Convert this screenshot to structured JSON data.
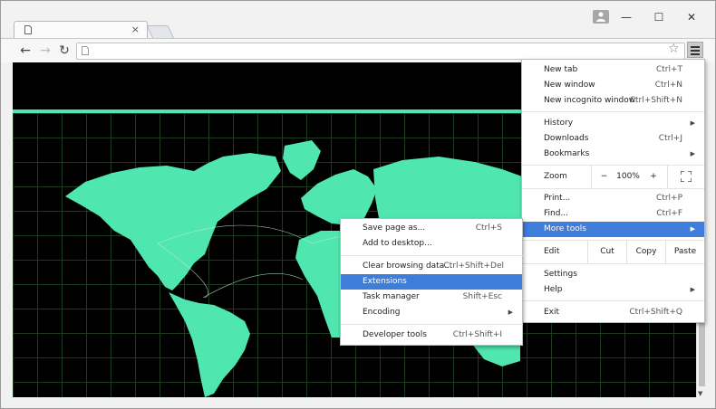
{
  "tab": {
    "title": "",
    "close": "×"
  },
  "window_controls": {
    "minimize": "—",
    "maximize": "☐",
    "close": "✕"
  },
  "nav": {
    "back": "←",
    "forward": "→",
    "reload": "↻"
  },
  "omnibox": {
    "value": "",
    "star": "☆"
  },
  "menu": {
    "new_tab": {
      "label": "New tab",
      "shortcut": "Ctrl+T"
    },
    "new_window": {
      "label": "New window",
      "shortcut": "Ctrl+N"
    },
    "new_incognito": {
      "label": "New incognito window",
      "shortcut": "Ctrl+Shift+N"
    },
    "history": {
      "label": "History"
    },
    "downloads": {
      "label": "Downloads",
      "shortcut": "Ctrl+J"
    },
    "bookmarks": {
      "label": "Bookmarks"
    },
    "zoom": {
      "label": "Zoom",
      "minus": "−",
      "value": "100%",
      "plus": "+",
      "fullscreen": "⛶"
    },
    "print": {
      "label": "Print...",
      "shortcut": "Ctrl+P"
    },
    "find": {
      "label": "Find...",
      "shortcut": "Ctrl+F"
    },
    "more_tools": {
      "label": "More tools"
    },
    "edit": {
      "label": "Edit",
      "cut": "Cut",
      "copy": "Copy",
      "paste": "Paste"
    },
    "settings": {
      "label": "Settings"
    },
    "help": {
      "label": "Help"
    },
    "exit": {
      "label": "Exit",
      "shortcut": "Ctrl+Shift+Q"
    }
  },
  "submenu": {
    "save_page": {
      "label": "Save page as...",
      "shortcut": "Ctrl+S"
    },
    "add_desktop": {
      "label": "Add to desktop..."
    },
    "clear_data": {
      "label": "Clear browsing data...",
      "shortcut": "Ctrl+Shift+Del"
    },
    "extensions": {
      "label": "Extensions"
    },
    "task_manager": {
      "label": "Task manager",
      "shortcut": "Shift+Esc"
    },
    "encoding": {
      "label": "Encoding"
    },
    "dev_tools": {
      "label": "Developer tools",
      "shortcut": "Ctrl+Shift+I"
    }
  },
  "colors": {
    "highlight": "#3e7dd9",
    "map": "#4fe6b0",
    "grid": "#1b3a1f"
  }
}
